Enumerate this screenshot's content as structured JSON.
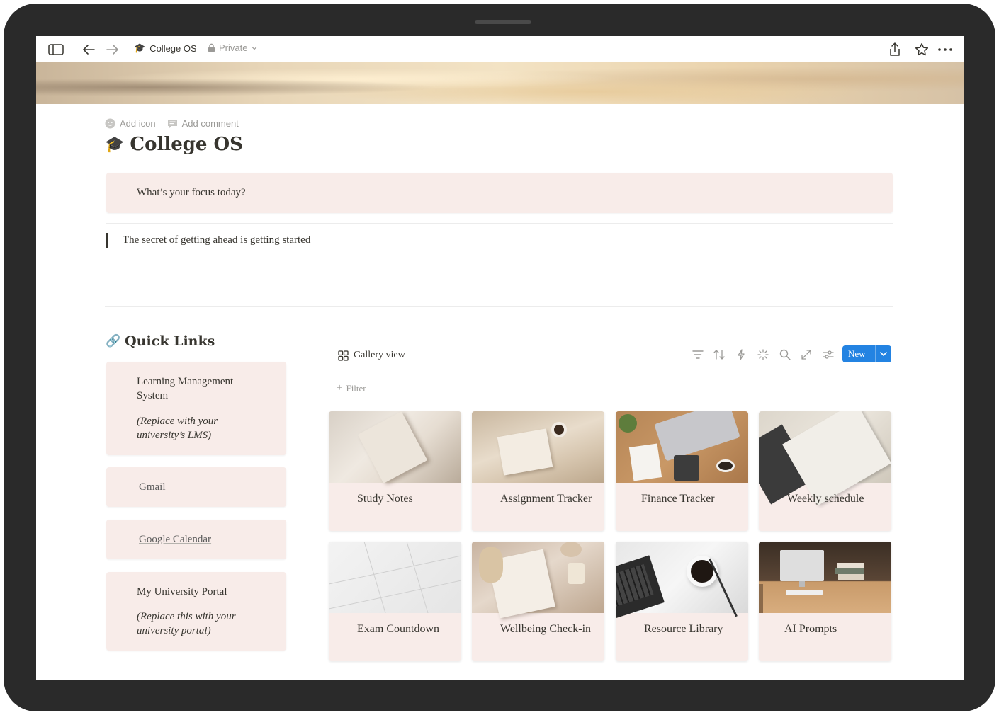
{
  "topbar": {
    "breadcrumb_emoji": "🎓",
    "breadcrumb_title": "College OS",
    "privacy_label": "Private"
  },
  "page": {
    "add_icon_label": "Add icon",
    "add_comment_label": "Add comment",
    "title_emoji": "🎓",
    "title": "College OS",
    "focus_prompt": "What’s your focus today?",
    "quote": "The secret of getting ahead is getting started"
  },
  "quick_links": {
    "emoji": "🔗",
    "title": "Quick Links",
    "items": [
      {
        "label": "Learning Management System",
        "note": "(Replace with your university’s LMS)"
      },
      {
        "label": "Gmail"
      },
      {
        "label": "Google Calendar"
      },
      {
        "label": "My University Portal",
        "note": "(Replace this with your university portal)"
      }
    ]
  },
  "gallery": {
    "view_label": "Gallery view",
    "new_label": "New",
    "filter_label": "Filter",
    "cards": [
      {
        "title": "Study Notes"
      },
      {
        "title": "Assignment Tracker"
      },
      {
        "title": "Finance Tracker"
      },
      {
        "title": "Weekly schedule"
      },
      {
        "title": "Exam Countdown"
      },
      {
        "title": "Wellbeing Check-in"
      },
      {
        "title": "Resource Library"
      },
      {
        "title": "AI Prompts"
      }
    ]
  },
  "colors": {
    "accent": "#2383e2",
    "card_bg": "#f8ece9",
    "text": "#37352f",
    "muted": "#9b9a97"
  }
}
